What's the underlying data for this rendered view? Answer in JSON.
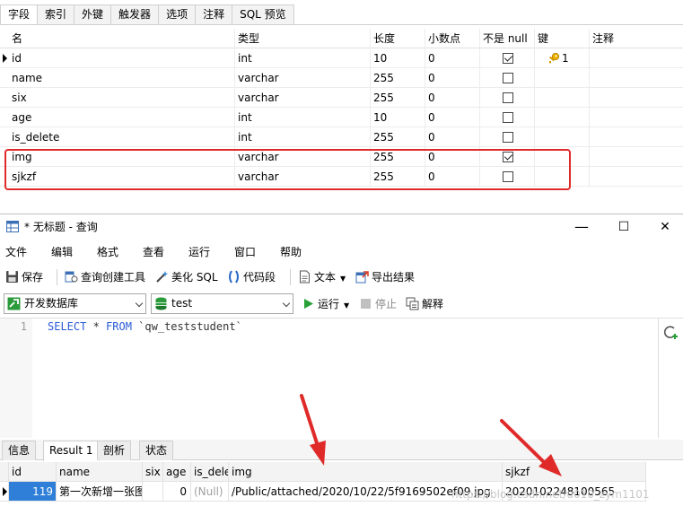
{
  "design": {
    "tabs": [
      {
        "label": "字段",
        "active": true
      },
      {
        "label": "索引"
      },
      {
        "label": "外键"
      },
      {
        "label": "触发器"
      },
      {
        "label": "选项"
      },
      {
        "label": "注释"
      },
      {
        "label": "SQL 预览"
      }
    ],
    "columns": {
      "name": "名",
      "type": "类型",
      "length": "长度",
      "decimals": "小数点",
      "not_null": "不是 null",
      "key": "键",
      "comment": "注释"
    },
    "fields": [
      {
        "name": "id",
        "type": "int",
        "length": "10",
        "decimals": "0",
        "not_null": true,
        "key": "1"
      },
      {
        "name": "name",
        "type": "varchar",
        "length": "255",
        "decimals": "0",
        "not_null": false,
        "key": ""
      },
      {
        "name": "six",
        "type": "varchar",
        "length": "255",
        "decimals": "0",
        "not_null": false,
        "key": ""
      },
      {
        "name": "age",
        "type": "int",
        "length": "10",
        "decimals": "0",
        "not_null": false,
        "key": ""
      },
      {
        "name": "is_delete",
        "type": "int",
        "length": "255",
        "decimals": "0",
        "not_null": false,
        "key": ""
      },
      {
        "name": "img",
        "type": "varchar",
        "length": "255",
        "decimals": "0",
        "not_null": true,
        "key": ""
      },
      {
        "name": "sjkzf",
        "type": "varchar",
        "length": "255",
        "decimals": "0",
        "not_null": false,
        "key": ""
      }
    ]
  },
  "query": {
    "title": "* 无标题 - 查询",
    "window_controls": {
      "minimize": "—",
      "maximize": "☐",
      "close": "✕"
    },
    "menu": [
      "文件",
      "编辑",
      "格式",
      "查看",
      "运行",
      "窗口",
      "帮助"
    ],
    "toolbar": {
      "save": "保存",
      "builder": "查询创建工具",
      "beautify": "美化 SQL",
      "snippet": "代码段",
      "text": "文本",
      "export": "导出结果"
    },
    "connection": "开发数据库",
    "database": "test",
    "run": "运行",
    "stop": "停止",
    "explain": "解释",
    "line_number": "1",
    "sql": {
      "kw1": "SELECT",
      "star": " * ",
      "kw2": "FROM",
      "table": " `qw_teststudent`"
    },
    "result_tabs": [
      "信息",
      "Result 1",
      "剖析",
      "状态"
    ],
    "result_columns": [
      "id",
      "name",
      "six",
      "age",
      "is_delete",
      "img",
      "sjkzf"
    ],
    "result_rows": [
      {
        "id": "119",
        "name": "第一次新增一张图",
        "six": "",
        "age": "0",
        "is_delete": "(Null)",
        "img": "/Public/attached/2020/10/22/5f9169502ef09.jpg",
        "sjkzf": "2020102248100565"
      }
    ],
    "watermark": "https://blog.csdn.net/u010_zym1101"
  },
  "colors": {
    "accent": "#2f7fd8",
    "highlight": "#e02a2a",
    "keyword": "#2a5bd7"
  }
}
